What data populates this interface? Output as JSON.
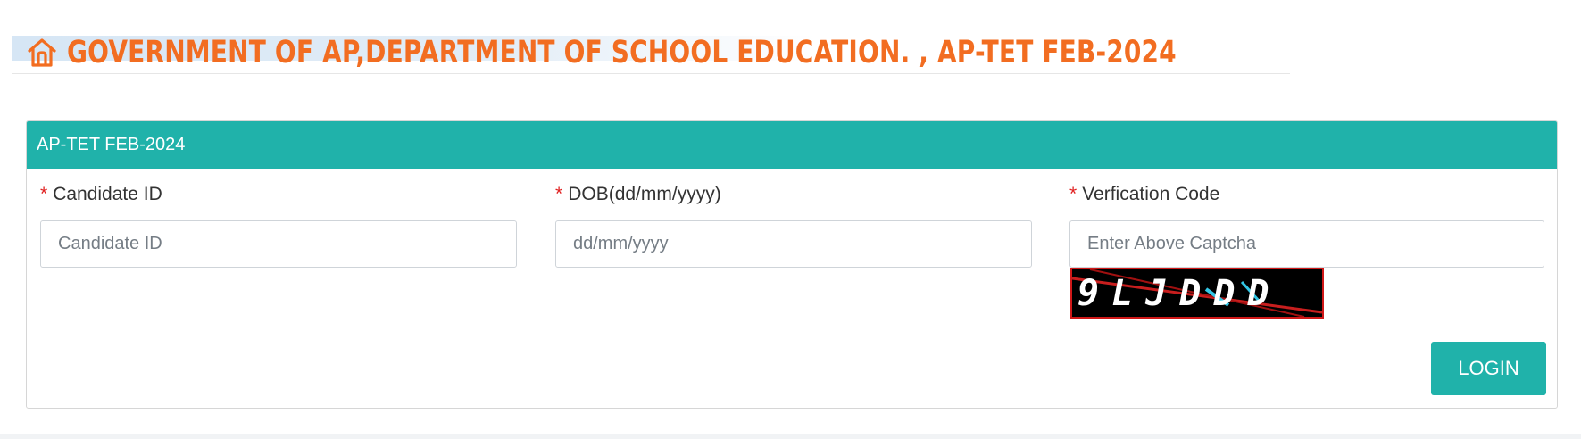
{
  "header": {
    "title": "GOVERNMENT OF AP,DEPARTMENT OF SCHOOL EDUCATION. , AP-TET FEB-2024",
    "icon": "home-icon",
    "title_color": "#f26d21"
  },
  "panel": {
    "heading": "AP-TET FEB-2024",
    "heading_bg": "#20b2aa"
  },
  "form": {
    "required_mark": "*",
    "candidate_id": {
      "label": "Candidate ID",
      "placeholder": "Candidate ID",
      "value": ""
    },
    "dob": {
      "label": "DOB(dd/mm/yyyy)",
      "placeholder": "dd/mm/yyyy",
      "value": ""
    },
    "verification": {
      "label": "Verfication Code",
      "placeholder": "Enter Above Captcha",
      "value": ""
    },
    "captcha_text": "9LJDDD",
    "login_label": "LOGIN"
  }
}
